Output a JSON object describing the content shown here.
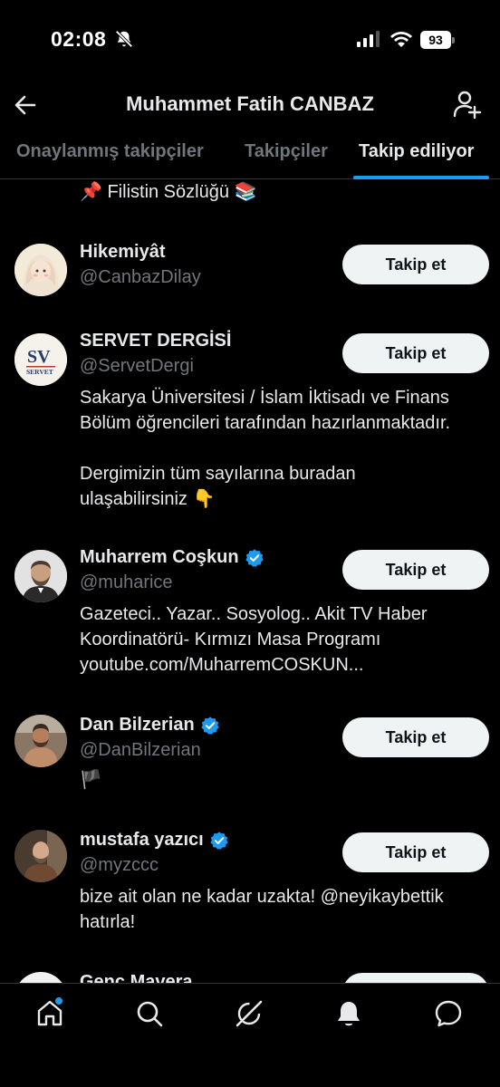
{
  "status_bar": {
    "time": "02:08",
    "battery": "93"
  },
  "header": {
    "title": "Muhammet Fatih CANBAZ"
  },
  "tabs": [
    {
      "label": "Onaylanmış takipçiler"
    },
    {
      "label": "Takipçiler"
    },
    {
      "label": "Takip ediliyor"
    }
  ],
  "previous_bio": "📌 Filistin Sözlüğü 📚",
  "users": [
    {
      "name": "Hikemiyât",
      "handle": "@CanbazDilay",
      "verified": false,
      "button": "Takip et",
      "bio": []
    },
    {
      "name": "SERVET DERGİSİ",
      "handle": "@ServetDergi",
      "verified": false,
      "button": "Takip et",
      "bio": [
        "Sakarya Üniversitesi / İslam İktisadı ve Finans",
        "Bölüm öğrencileri tarafından hazırlanmaktadır.",
        "",
        "Dergimizin tüm sayılarına buradan",
        "ulaşabilirsiniz 👇"
      ]
    },
    {
      "name": "Muharrem Coşkun",
      "handle": "@muharice",
      "verified": true,
      "button": "Takip et",
      "bio": [
        "Gazeteci.. Yazar.. Sosyolog.. Akit TV Haber",
        "Koordinatörü- Kırmızı Masa Programı",
        "youtube.com/MuharremCOSKUN..."
      ]
    },
    {
      "name": "Dan Bilzerian",
      "handle": "@DanBilzerian",
      "verified": true,
      "button": "Takip et",
      "bio": [
        "🏴"
      ]
    },
    {
      "name": "mustafa yazıcı",
      "handle": "@myzccc",
      "verified": true,
      "button": "Takip et",
      "bio": [
        "bize ait olan ne kadar uzakta! @neyikaybettik",
        "hatırla!"
      ]
    },
    {
      "name": "Genç Mavera",
      "handle": "",
      "verified": false,
      "button": "",
      "bio": []
    }
  ],
  "avatar_logo_text": {
    "mark": "SV",
    "word": "SERVET"
  },
  "colors": {
    "accent": "#1d9bf0",
    "muted": "#71767b",
    "button_bg": "#eff3f4"
  }
}
